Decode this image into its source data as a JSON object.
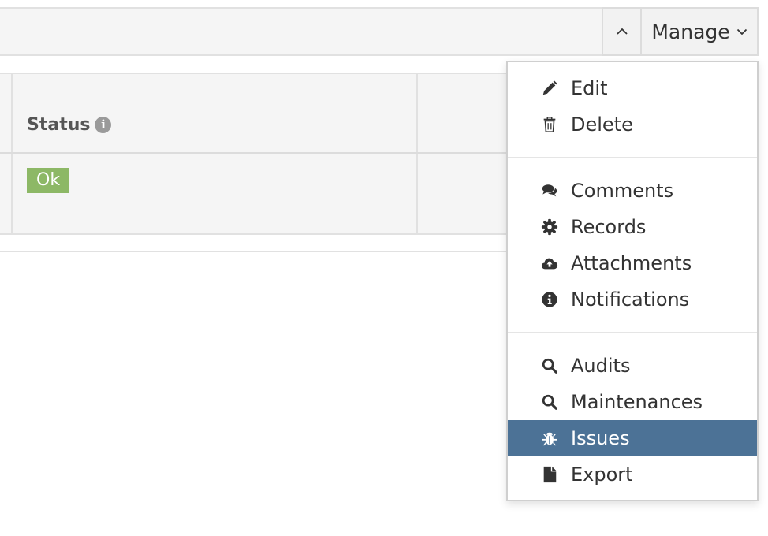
{
  "toolbar": {
    "manage_label": "Manage"
  },
  "table": {
    "status_header": "Status",
    "status_value": "Ok",
    "status_color": "#8db866"
  },
  "menu": {
    "active_color": "#4c7296",
    "groups": [
      [
        {
          "label": "Edit",
          "icon": "pencil-icon"
        },
        {
          "label": "Delete",
          "icon": "trash-icon"
        }
      ],
      [
        {
          "label": "Comments",
          "icon": "comments-icon"
        },
        {
          "label": "Records",
          "icon": "gear-icon"
        },
        {
          "label": "Attachments",
          "icon": "cloud-upload-icon"
        },
        {
          "label": "Notifications",
          "icon": "info-icon"
        }
      ],
      [
        {
          "label": "Audits",
          "icon": "search-icon"
        },
        {
          "label": "Maintenances",
          "icon": "search-icon"
        },
        {
          "label": "Issues",
          "icon": "bug-icon",
          "active": true
        },
        {
          "label": "Export",
          "icon": "file-icon"
        }
      ]
    ]
  }
}
